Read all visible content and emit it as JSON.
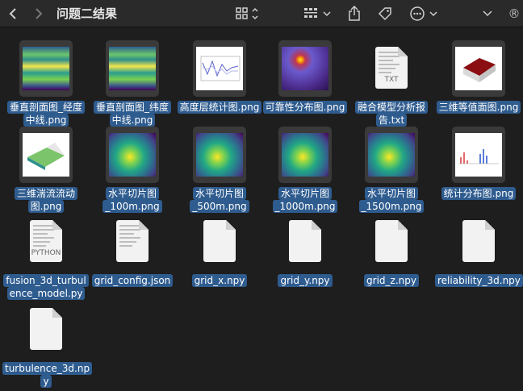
{
  "window": {
    "title": "问题二结果"
  },
  "toolbar": {
    "back_icon": "chevron-left-icon",
    "forward_icon": "chevron-right-icon",
    "view_icon": "icon-grid-icon",
    "group_icon": "group-icon",
    "share_icon": "share-icon",
    "tag_icon": "tag-icon",
    "more_icon": "ellipsis-circle-icon",
    "registered_symbol": "®"
  },
  "files": [
    {
      "name_lines": [
        "垂直剖面图_经度",
        "中线.png"
      ],
      "kind": "heatmap-h"
    },
    {
      "name_lines": [
        "垂直剖面图_纬度",
        "中线.png"
      ],
      "kind": "heatmap-h"
    },
    {
      "name_lines": [
        "高度层统计图.png"
      ],
      "kind": "line-plot"
    },
    {
      "name_lines": [
        "可靠性分布图.png"
      ],
      "kind": "purple-map"
    },
    {
      "name_lines": [
        "融合模型分析报",
        "告.txt"
      ],
      "kind": "txt",
      "doc_tag": "TXT"
    },
    {
      "name_lines": [
        "三维等值面图.png"
      ],
      "kind": "surface"
    },
    {
      "name_lines": [
        "三维湍流流动",
        "图.png"
      ],
      "kind": "surface-3d"
    },
    {
      "name_lines": [
        "水平切片图",
        "_100m.png"
      ],
      "kind": "viridis"
    },
    {
      "name_lines": [
        "水平切片图",
        "_500m.png"
      ],
      "kind": "viridis"
    },
    {
      "name_lines": [
        "水平切片图",
        "_1000m.png"
      ],
      "kind": "viridis"
    },
    {
      "name_lines": [
        "水平切片图",
        "_1500m.png"
      ],
      "kind": "viridis"
    },
    {
      "name_lines": [
        "统计分布图.png"
      ],
      "kind": "stats"
    },
    {
      "name_lines": [
        "fusion_3d_turbul",
        "ence_model.py"
      ],
      "kind": "python",
      "doc_tag": "PYTHON"
    },
    {
      "name_lines": [
        "grid_config.json"
      ],
      "kind": "json"
    },
    {
      "name_lines": [
        "grid_x.npy"
      ],
      "kind": "blank"
    },
    {
      "name_lines": [
        "grid_y.npy"
      ],
      "kind": "blank"
    },
    {
      "name_lines": [
        "grid_z.npy"
      ],
      "kind": "blank"
    },
    {
      "name_lines": [
        "reliability_3d.npy"
      ],
      "kind": "blank"
    },
    {
      "name_lines": [
        "turbulence_3d.np",
        "y"
      ],
      "kind": "blank"
    }
  ]
}
